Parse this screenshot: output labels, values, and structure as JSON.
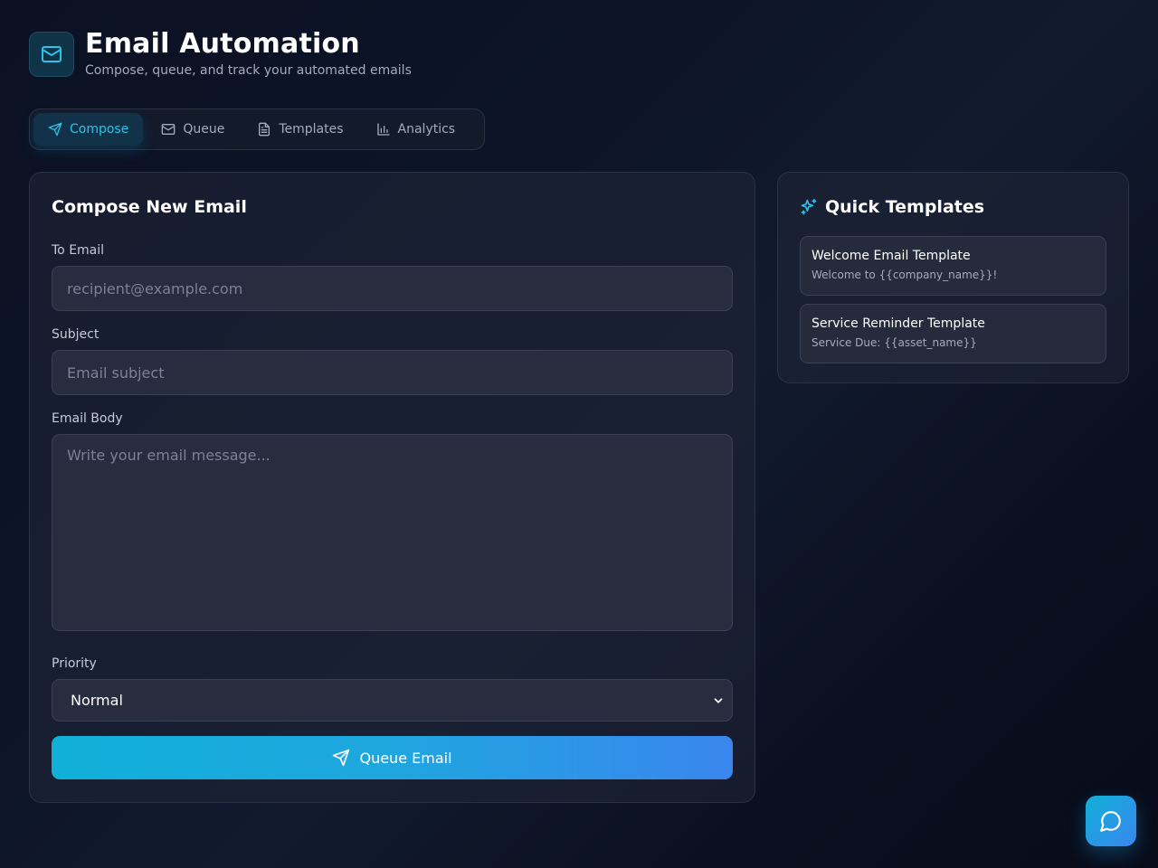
{
  "header": {
    "title": "Email Automation",
    "subtitle": "Compose, queue, and track your automated emails",
    "logo_icon": "mail-icon"
  },
  "tabs": [
    {
      "label": "Compose",
      "icon": "send-icon",
      "active": true
    },
    {
      "label": "Queue",
      "icon": "mail-icon",
      "active": false
    },
    {
      "label": "Templates",
      "icon": "document-icon",
      "active": false
    },
    {
      "label": "Analytics",
      "icon": "bar-chart-icon",
      "active": false
    }
  ],
  "compose": {
    "title": "Compose New Email",
    "to_label": "To Email",
    "to_placeholder": "recipient@example.com",
    "subject_label": "Subject",
    "subject_placeholder": "Email subject",
    "body_label": "Email Body",
    "body_placeholder": "Write your email message...",
    "priority_label": "Priority",
    "priority_value": "Normal",
    "submit_label": "Queue Email"
  },
  "quick_templates": {
    "title": "Quick Templates",
    "icon": "sparkles-icon",
    "items": [
      {
        "name": "Welcome Email Template",
        "subject": "Welcome to {{company_name}}!"
      },
      {
        "name": "Service Reminder Template",
        "subject": "Service Due: {{asset_name}}"
      }
    ]
  },
  "colors": {
    "accent": "#2cc1e8",
    "button_gradient_start": "#10b0d8",
    "button_gradient_end": "#3a86ee",
    "background": "#0d1428"
  }
}
